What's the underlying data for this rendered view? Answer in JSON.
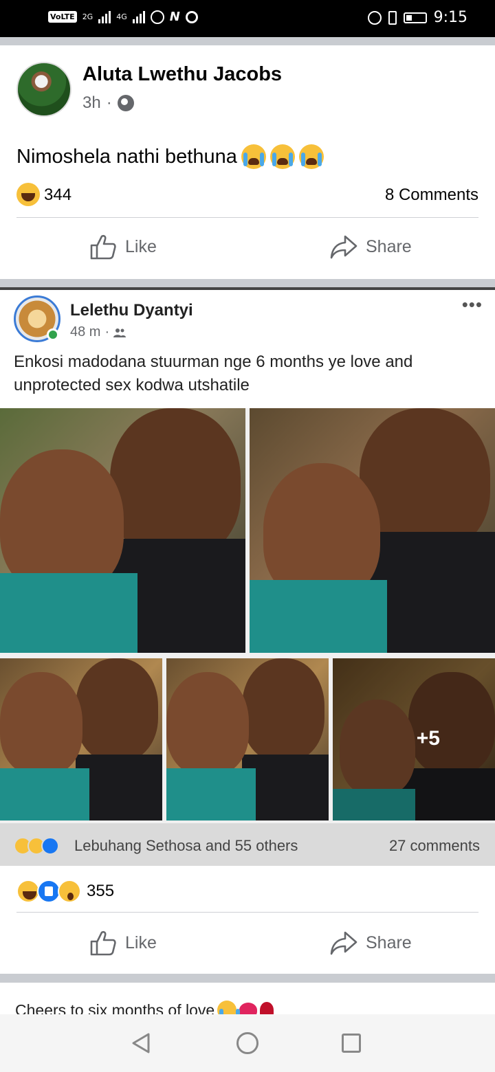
{
  "status_bar": {
    "volte": "VoLTE",
    "sim1": "2G",
    "sim2": "4G",
    "time": "9:15"
  },
  "post1": {
    "author": "Aluta Lwethu Jacobs",
    "time": "3h",
    "text": "Nimoshela nathi bethuna",
    "reaction_count": "344",
    "comments": "8 Comments",
    "like_label": "Like",
    "share_label": "Share"
  },
  "shared_post": {
    "author": "Lelethu Dyantyi",
    "time": "48 m",
    "text": "Enkosi madodana stuurman nge 6 months ye love and unprotected sex kodwa utshatile",
    "more_photos": "+5",
    "reacted_by": "Lebuhang Sethosa and 55 others",
    "comments": "27 comments"
  },
  "post1_footer": {
    "reaction_count": "355",
    "like_label": "Like",
    "share_label": "Share"
  },
  "post2": {
    "text": "Cheers to six months of love"
  },
  "colors": {
    "accent": "#1877f2",
    "secondary_text": "#65676b",
    "divider": "#ced0d4"
  }
}
